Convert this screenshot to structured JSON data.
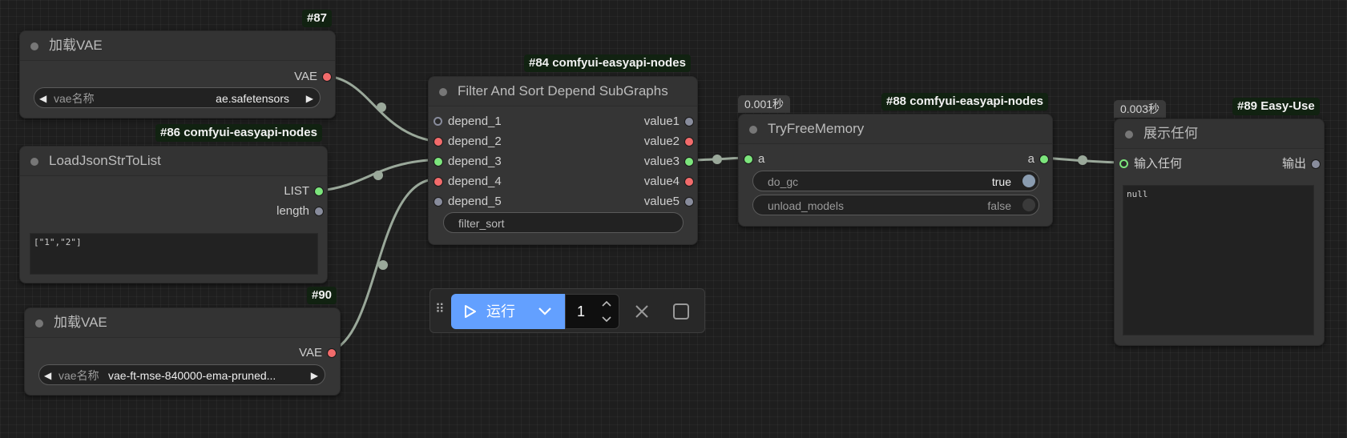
{
  "nodes": {
    "n87": {
      "badge": "#87",
      "title": "加载VAE",
      "output_label": "VAE",
      "widget_label": "vae名称",
      "widget_value": "ae.safetensors"
    },
    "n86": {
      "badge": "#86 comfyui-easyapi-nodes",
      "title": "LoadJsonStrToList",
      "outputs": [
        "LIST",
        "length"
      ],
      "text_value": "[\"1\",\"2\"]"
    },
    "n90": {
      "badge": "#90",
      "title": "加载VAE",
      "output_label": "VAE",
      "widget_label": "vae名称",
      "widget_value": "vae-ft-mse-840000-ema-pruned..."
    },
    "n84": {
      "badge": "#84 comfyui-easyapi-nodes",
      "title": "Filter And Sort Depend SubGraphs",
      "inputs": [
        "depend_1",
        "depend_2",
        "depend_3",
        "depend_4",
        "depend_5"
      ],
      "outputs": [
        "value1",
        "value2",
        "value3",
        "value4",
        "value5"
      ],
      "widget_label": "filter_sort"
    },
    "n88": {
      "badge": "#88 comfyui-easyapi-nodes",
      "timing": "0.001秒",
      "title": "TryFreeMemory",
      "input_label": "a",
      "output_label": "a",
      "toggles": [
        {
          "label": "do_gc",
          "value": "true"
        },
        {
          "label": "unload_models",
          "value": "false"
        }
      ]
    },
    "n89": {
      "badge": "#89 Easy-Use",
      "timing": "0.003秒",
      "title": "展示任何",
      "input_label": "输入任何",
      "output_label": "输出",
      "text_value": "null"
    }
  },
  "toolbar": {
    "run_label": "运行",
    "queue_count": "1"
  },
  "colors": {
    "wire": "#9aa89a",
    "run_button": "#63a0ff",
    "vae_slot": "#f26b6b",
    "list_slot": "#7ce57c",
    "any_slot": "#888c9c"
  }
}
